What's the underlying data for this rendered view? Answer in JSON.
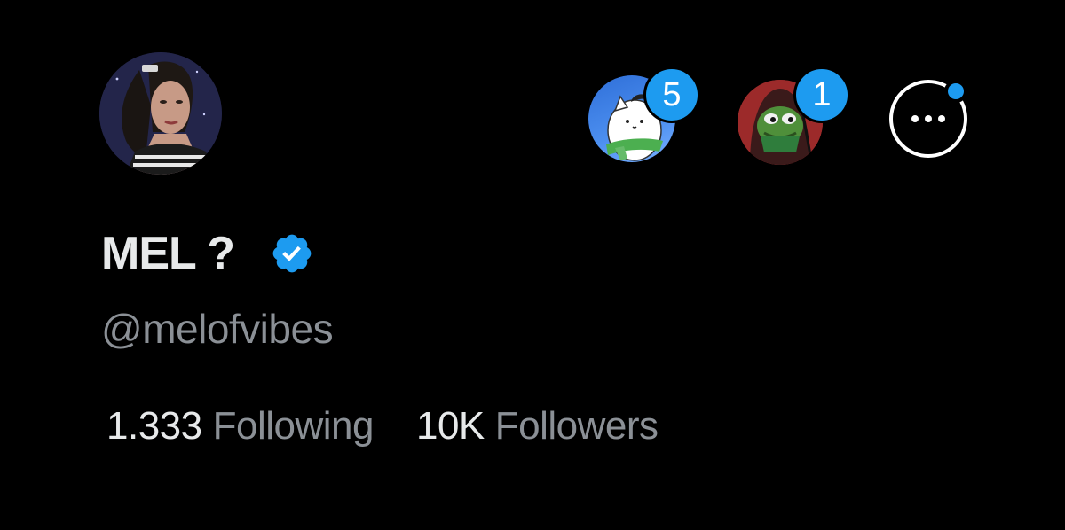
{
  "profile": {
    "display_name": "MEL ?",
    "handle": "@melofvibes",
    "verified": true,
    "avatar_icon": "profile-photo"
  },
  "account_switcher": [
    {
      "avatar_icon": "white-cat-green-scarf-avatar",
      "badge_count": "5"
    },
    {
      "avatar_icon": "hooded-frog-avatar",
      "badge_count": "1"
    }
  ],
  "more_button": {
    "icon": "more-horizontal-icon",
    "has_notification_dot": true
  },
  "stats": {
    "following_count": "1.333",
    "following_label": "Following",
    "followers_count": "10K",
    "followers_label": "Followers"
  },
  "colors": {
    "background": "#000000",
    "primary_text": "#e7e9ea",
    "secondary_text": "#8b9096",
    "accent": "#1d9bf0"
  }
}
